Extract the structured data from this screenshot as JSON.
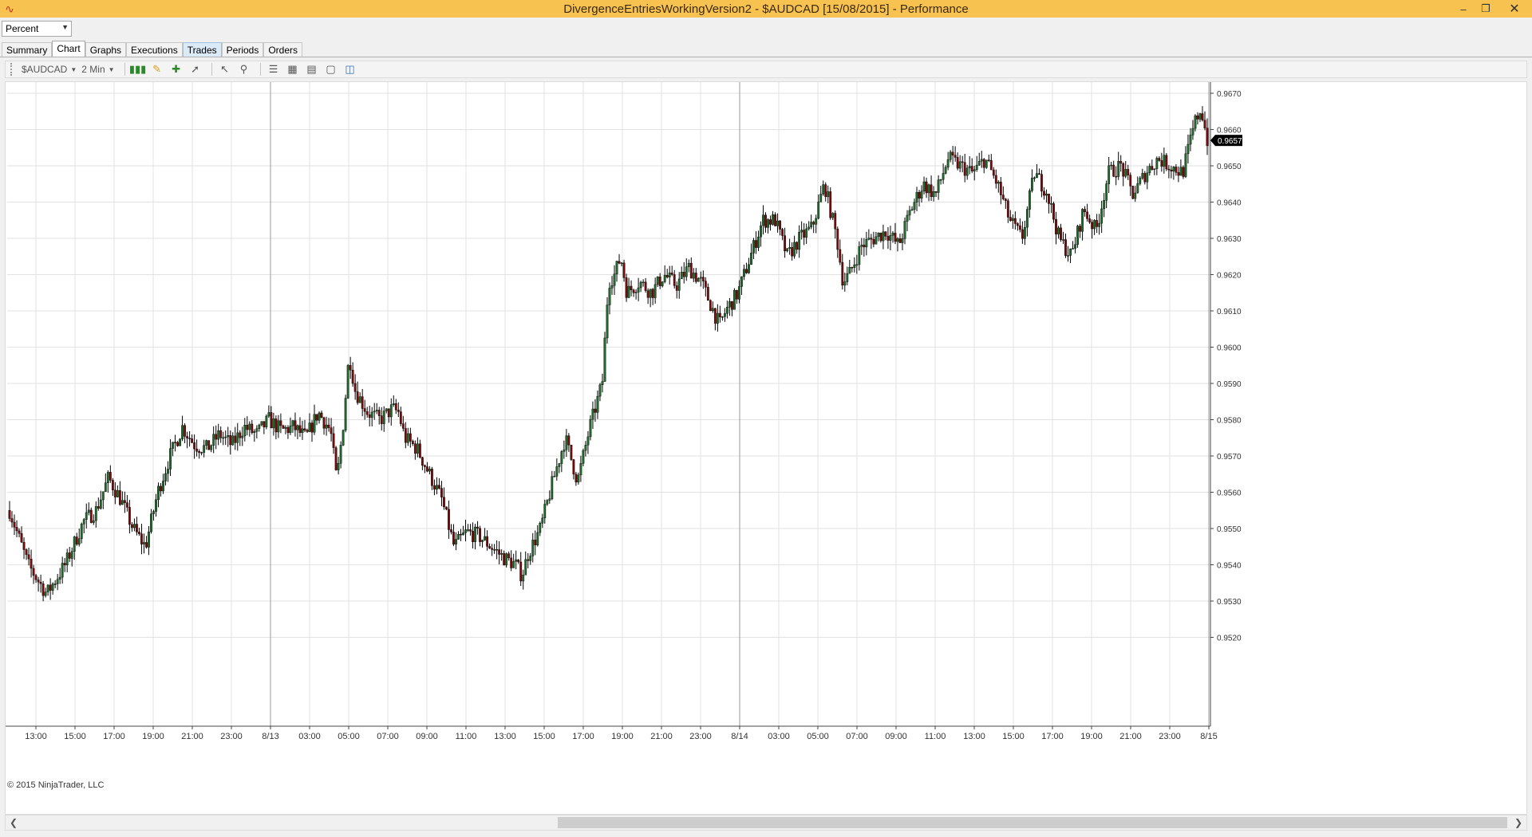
{
  "window": {
    "title": "DivergenceEntriesWorkingVersion2 - $AUDCAD [15/08/2015] - Performance",
    "minimize_glyph": "–",
    "restore_glyph": "❐",
    "close_glyph": "✕"
  },
  "display_select": {
    "value": "Percent"
  },
  "tabs": [
    {
      "label": "Summary"
    },
    {
      "label": "Chart"
    },
    {
      "label": "Graphs"
    },
    {
      "label": "Executions"
    },
    {
      "label": "Trades"
    },
    {
      "label": "Periods"
    },
    {
      "label": "Orders"
    }
  ],
  "toolbar": {
    "instrument": "$AUDCAD",
    "interval": "2 Min",
    "icons": [
      "bar-style-icon",
      "drawing-pencil-icon",
      "draw-tools-icon",
      "crosshair-icon",
      "cursor-icon",
      "zoom-icon",
      "properties-icon",
      "strategies-icon",
      "indicators-icon",
      "data-box-icon",
      "window-layout-icon"
    ]
  },
  "colors": {
    "up": "#1e6b2a",
    "down": "#7a0a0a",
    "wick": "#000000",
    "grid": "#e2e2e2",
    "accent": "#f7c24f"
  },
  "chart_data": {
    "type": "candlestick",
    "instrument": "$AUDCAD",
    "interval": "2 Min",
    "y_ticks": [
      "0.9670",
      "0.9660",
      "0.9650",
      "0.9640",
      "0.9630",
      "0.9620",
      "0.9610",
      "0.9600",
      "0.9590",
      "0.9580",
      "0.9570",
      "0.9560",
      "0.9550",
      "0.9540",
      "0.9530",
      "0.9520"
    ],
    "x_ticks": [
      "13:00",
      "15:00",
      "17:00",
      "19:00",
      "21:00",
      "23:00",
      "8/13",
      "03:00",
      "05:00",
      "07:00",
      "09:00",
      "11:00",
      "13:00",
      "15:00",
      "17:00",
      "19:00",
      "21:00",
      "23:00",
      "8/14",
      "03:00",
      "05:00",
      "07:00",
      "09:00",
      "11:00",
      "13:00",
      "15:00",
      "17:00",
      "19:00",
      "21:00",
      "23:00",
      "8/15"
    ],
    "ylim": [
      0.952,
      0.9675
    ],
    "last_price": "0.9657",
    "path": [
      [
        0,
        0.9555
      ],
      [
        1.5,
        0.954
      ],
      [
        3,
        0.9532
      ],
      [
        4.5,
        0.954
      ],
      [
        6,
        0.9552
      ],
      [
        7,
        0.9555
      ],
      [
        8,
        0.9564
      ],
      [
        9,
        0.9558
      ],
      [
        10,
        0.955
      ],
      [
        11,
        0.9545
      ],
      [
        12,
        0.956
      ],
      [
        13,
        0.957
      ],
      [
        14,
        0.9578
      ],
      [
        15,
        0.9573
      ],
      [
        16,
        0.9572
      ],
      [
        17,
        0.9576
      ],
      [
        18,
        0.9573
      ],
      [
        19,
        0.9578
      ],
      [
        20,
        0.9576
      ],
      [
        21,
        0.958
      ],
      [
        22,
        0.9577
      ],
      [
        23,
        0.9578
      ],
      [
        24,
        0.9575
      ],
      [
        25,
        0.9582
      ],
      [
        26,
        0.9577
      ],
      [
        26.5,
        0.9563
      ],
      [
        27,
        0.9578
      ],
      [
        27.5,
        0.9598
      ],
      [
        28,
        0.9588
      ],
      [
        29,
        0.9582
      ],
      [
        30,
        0.958
      ],
      [
        31,
        0.9583
      ],
      [
        31.5,
        0.9582
      ],
      [
        32,
        0.9575
      ],
      [
        33,
        0.9572
      ],
      [
        34,
        0.9565
      ],
      [
        35,
        0.9558
      ],
      [
        36,
        0.9545
      ],
      [
        37,
        0.9549
      ],
      [
        38,
        0.9548
      ],
      [
        39,
        0.9545
      ],
      [
        40,
        0.9542
      ],
      [
        41,
        0.954
      ],
      [
        41.5,
        0.9537
      ],
      [
        42,
        0.9543
      ],
      [
        43,
        0.955
      ],
      [
        44,
        0.9563
      ],
      [
        45,
        0.9575
      ],
      [
        46,
        0.9563
      ],
      [
        47,
        0.9578
      ],
      [
        48,
        0.959
      ],
      [
        48.5,
        0.9618
      ],
      [
        49,
        0.962
      ],
      [
        49.5,
        0.9625
      ],
      [
        50,
        0.9615
      ],
      [
        51,
        0.9618
      ],
      [
        52,
        0.9615
      ],
      [
        53,
        0.962
      ],
      [
        54,
        0.9617
      ],
      [
        55,
        0.9622
      ],
      [
        56,
        0.9618
      ],
      [
        57,
        0.961
      ],
      [
        57.5,
        0.9606
      ],
      [
        58,
        0.961
      ],
      [
        59,
        0.9615
      ],
      [
        60,
        0.9625
      ],
      [
        61,
        0.9635
      ],
      [
        62,
        0.9635
      ],
      [
        63,
        0.9625
      ],
      [
        64,
        0.963
      ],
      [
        65,
        0.9633
      ],
      [
        66,
        0.9645
      ],
      [
        67,
        0.963
      ],
      [
        67.5,
        0.9618
      ],
      [
        68,
        0.962
      ],
      [
        69,
        0.9628
      ],
      [
        70,
        0.963
      ],
      [
        71,
        0.9632
      ],
      [
        72,
        0.9628
      ],
      [
        73,
        0.9638
      ],
      [
        74,
        0.9645
      ],
      [
        75,
        0.9642
      ],
      [
        76,
        0.9652
      ],
      [
        77,
        0.965
      ],
      [
        78,
        0.9648
      ],
      [
        79,
        0.9652
      ],
      [
        80,
        0.9645
      ],
      [
        81,
        0.9635
      ],
      [
        82,
        0.963
      ],
      [
        83,
        0.9648
      ],
      [
        84,
        0.9643
      ],
      [
        85,
        0.963
      ],
      [
        86,
        0.9625
      ],
      [
        87,
        0.9638
      ],
      [
        88,
        0.9632
      ],
      [
        89,
        0.9648
      ],
      [
        90,
        0.965
      ],
      [
        91,
        0.9642
      ],
      [
        92,
        0.9648
      ],
      [
        93,
        0.9652
      ],
      [
        94,
        0.965
      ],
      [
        95,
        0.9648
      ],
      [
        96,
        0.9662
      ],
      [
        96.5,
        0.9666
      ],
      [
        97,
        0.9657
      ]
    ]
  }
}
